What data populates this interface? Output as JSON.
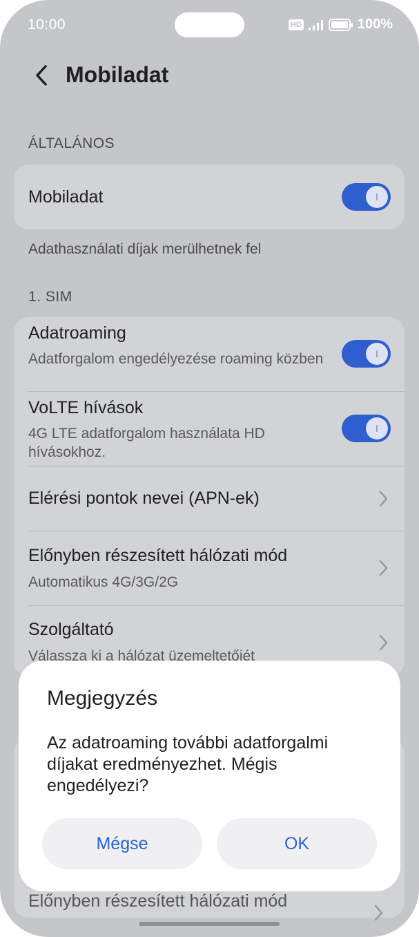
{
  "status_bar": {
    "time": "10:00",
    "hd": "HD",
    "battery": "100%"
  },
  "header": {
    "title": "Mobiladat"
  },
  "general": {
    "section_label": "ÁLTALÁNOS",
    "mobile_data": {
      "label": "Mobiladat",
      "enabled": true
    },
    "hint": "Adathasználati díjak merülhetnek fel"
  },
  "sim": {
    "section_label": "1. SIM",
    "items": [
      {
        "title": "Adatroaming",
        "subtitle": "Adatforgalom engedélyezése roaming közben",
        "enabled": true
      },
      {
        "title": "VoLTE hívások",
        "subtitle": "4G LTE adatforgalom használata HD hívásokhoz.",
        "enabled": true
      },
      {
        "title": "Elérési pontok nevei (APN-ek)"
      },
      {
        "title": "Előnyben részesített hálózati mód",
        "subtitle": "Automatikus 4G/3G/2G"
      },
      {
        "title": "Szolgáltató",
        "subtitle": "Válassza ki a hálózat üzemeltetőjét"
      }
    ]
  },
  "background_peek": {
    "text": "Előnyben részesített hálózati mód"
  },
  "dialog": {
    "title": "Megjegyzés",
    "message": "Az adatroaming további adatforgalmi díjakat eredményezhet. Mégis engedélyezi?",
    "cancel_label": "Mégse",
    "ok_label": "OK"
  },
  "colors": {
    "accent": "#2f5fcf",
    "dialog_button_text": "#2d63d8",
    "dimmed_background": "#c5c6ca"
  }
}
